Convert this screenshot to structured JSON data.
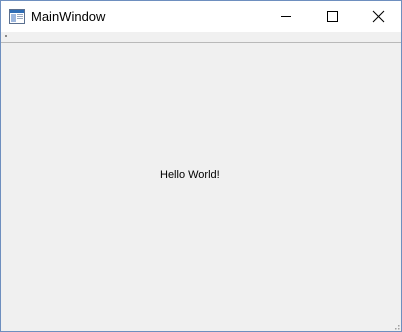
{
  "window": {
    "title": "MainWindow",
    "app_icon": "application-window-icon",
    "buttons": {
      "minimize": "minimize-icon",
      "maximize": "maximize-icon",
      "close": "close-icon"
    }
  },
  "central": {
    "label": "Hello World!"
  },
  "colors": {
    "titlebar_bg": "#ffffff",
    "client_bg": "#f0f0f0",
    "window_border": "#6e8fbf",
    "icon_blue": "#2f6db5"
  }
}
